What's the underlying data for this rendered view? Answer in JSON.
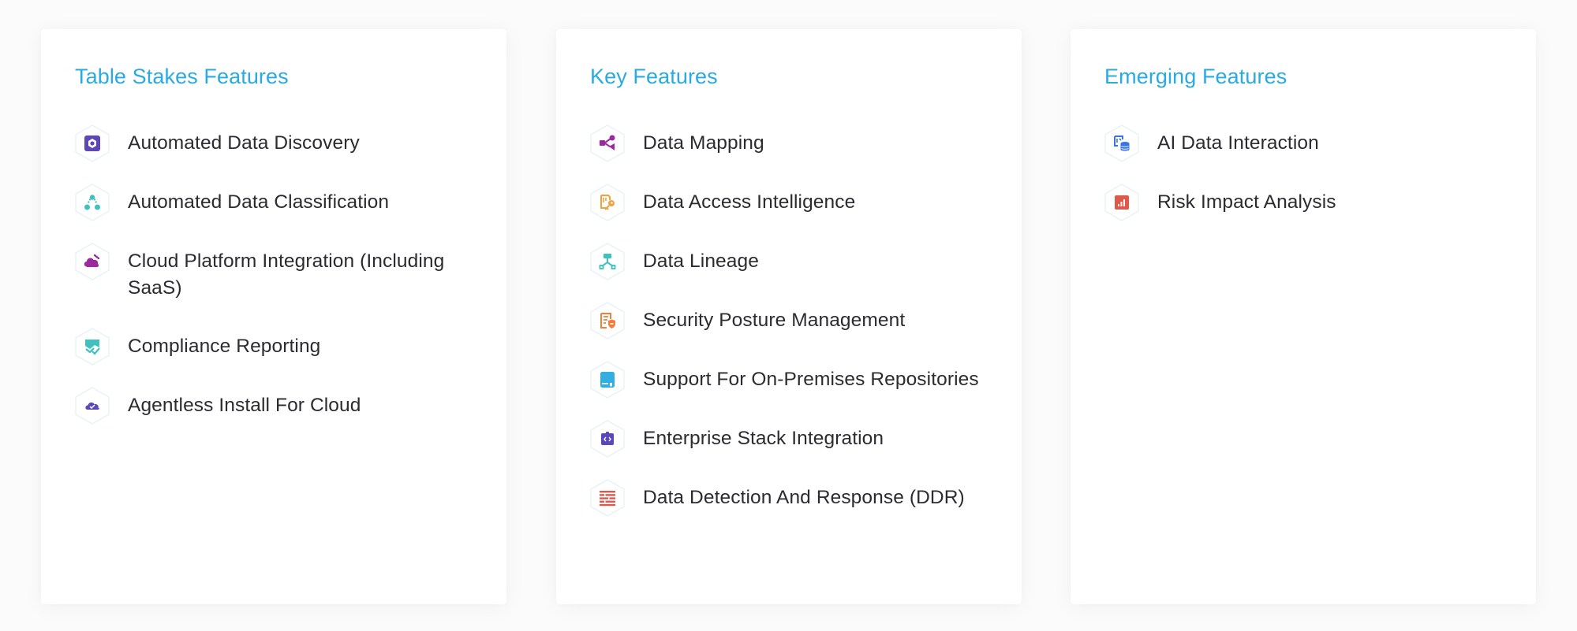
{
  "colors": {
    "title": "#29abe2",
    "text": "#2b2b30",
    "hex_outline": "#e3f0f6",
    "purple": "#5b47b5",
    "magenta": "#9a2a9e",
    "teal": "#3fc1bf",
    "orange": "#f0a23c",
    "coral": "#f07f3c",
    "sky": "#33aee0",
    "red": "#e0574b",
    "blue": "#3a73e8"
  },
  "cards": [
    {
      "title": "Table Stakes Features",
      "items": [
        {
          "label": "Automated Data Discovery",
          "icon": "discovery-icon"
        },
        {
          "label": "Automated Data Classification",
          "icon": "classification-icon"
        },
        {
          "label": "Cloud Platform Integration (Including SaaS)",
          "icon": "cloud-platform-icon"
        },
        {
          "label": "Compliance Reporting",
          "icon": "compliance-report-icon"
        },
        {
          "label": "Agentless Install For Cloud",
          "icon": "cloud-check-icon"
        }
      ]
    },
    {
      "title": "Key Features",
      "items": [
        {
          "label": "Data Mapping",
          "icon": "share-nodes-icon"
        },
        {
          "label": "Data Access Intelligence",
          "icon": "access-key-icon"
        },
        {
          "label": "Data Lineage",
          "icon": "lineage-tree-icon"
        },
        {
          "label": "Security Posture Management",
          "icon": "document-shield-icon"
        },
        {
          "label": "Support For On-Premises Repositories",
          "icon": "repository-icon"
        },
        {
          "label": "Enterprise Stack Integration",
          "icon": "code-badge-icon"
        },
        {
          "label": "Data Detection And Response (DDR)",
          "icon": "firewall-icon"
        }
      ]
    },
    {
      "title": "Emerging Features",
      "items": [
        {
          "label": "AI Data Interaction",
          "icon": "ai-database-icon"
        },
        {
          "label": "Risk Impact Analysis",
          "icon": "bar-chart-icon"
        }
      ]
    }
  ]
}
